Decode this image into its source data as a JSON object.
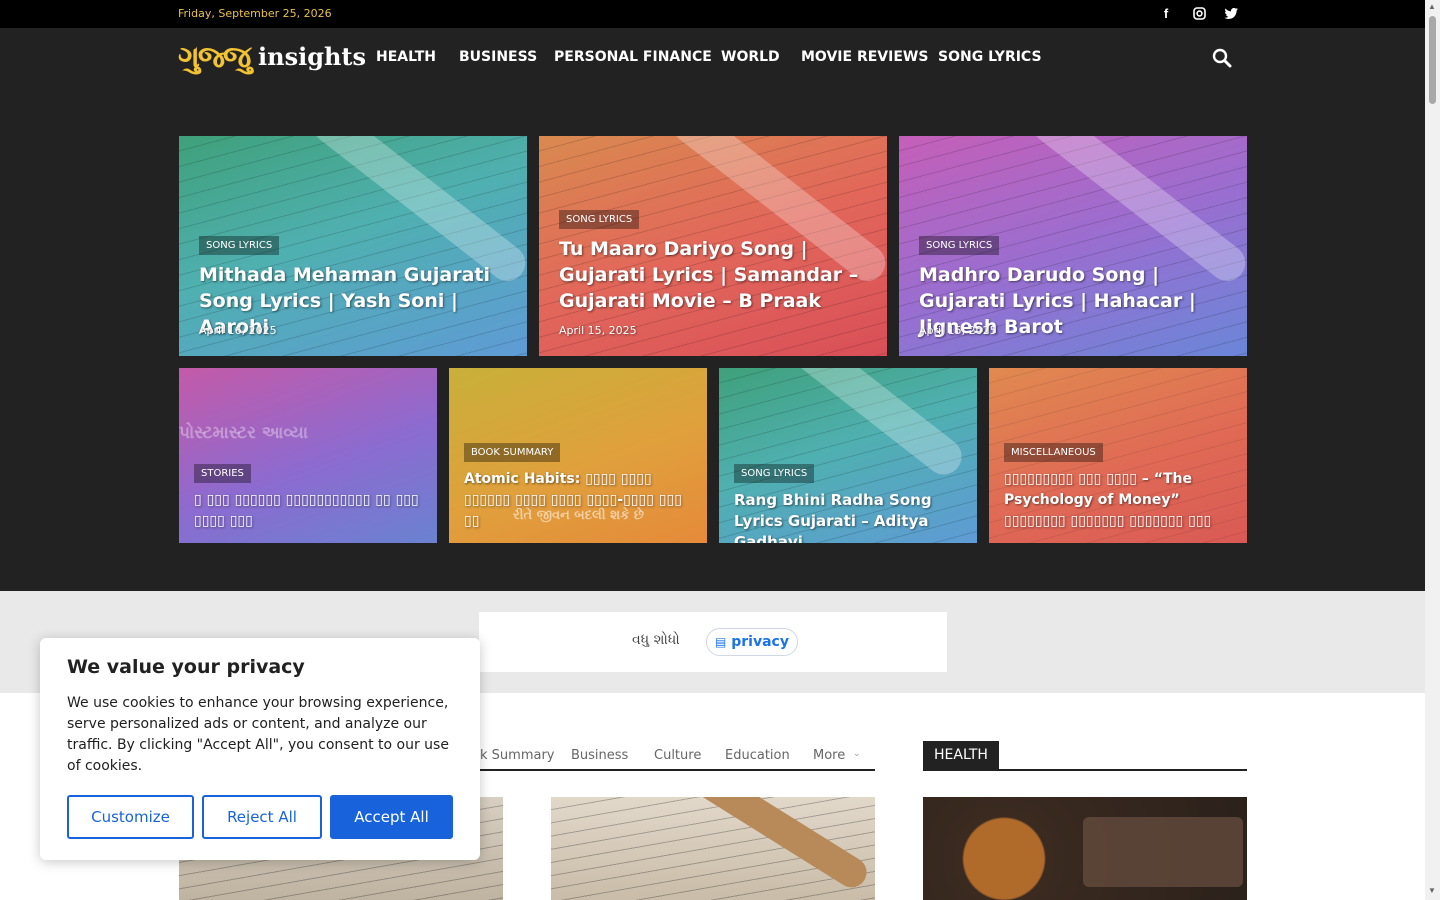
{
  "topbar": {
    "date": "Friday, September 25, 2026",
    "social": [
      "facebook-icon",
      "instagram-icon",
      "twitter-icon"
    ]
  },
  "header": {
    "logo_gujarati": "ગુજ્જુ",
    "logo_text": "insights",
    "nav": [
      "HEALTH",
      "BUSINESS",
      "PERSONAL FINANCE",
      "WORLD",
      "MOVIE REVIEWS",
      "SONG LYRICS"
    ]
  },
  "hero": {
    "top": [
      {
        "category": "SONG LYRICS",
        "title": "Mithada Mehaman Gujarati Song Lyrics | Yash Soni | Aarohi",
        "date": "April 16, 2025"
      },
      {
        "category": "SONG LYRICS",
        "title": "Tu Maaro Dariyo Song | Gujarati Lyrics | Samandar – Gujarati Movie – B Praak",
        "date": "April 15, 2025"
      },
      {
        "category": "SONG LYRICS",
        "title": "Madhro Darudo Song | Gujarati Lyrics | Hahacar | Jignesh Barot",
        "date": "April 15, 2025"
      }
    ],
    "bottom": [
      {
        "category": "STORIES",
        "title": "▯ ▯▯▯ ▯▯▯▯▯▯ ▯▯▯▯▯▯▯▯▯▯▯ ▯▯ ▯▯▯ ▯▯▯▯ ▯▯▯",
        "overlay": "પોસ્ટમાસ્ટર આવ્યા"
      },
      {
        "category": "BOOK SUMMARY",
        "title": "Atomic Habits: ▯▯▯▯ ▯▯▯▯ ▯▯▯▯▯▯ ▯▯▯▯ ▯▯▯▯ ▯▯▯▯-▯▯▯▯ ▯▯▯ ▯▯",
        "overlay": "રીતે જીવન બદલી શકે છે"
      },
      {
        "category": "SONG LYRICS",
        "title": "Rang Bhini Radha Song Lyrics Gujarati – Aditya Gadhavi",
        "overlay": ""
      },
      {
        "category": "MISCELLANEOUS",
        "title": "▯▯▯▯▯▯▯▯▯ ▯▯▯ ▯▯▯▯ – “The Psychology of Money” ▯▯▯▯▯▯▯▯ ▯▯▯▯▯▯▯ ▯▯▯▯▯▯▯ ▯▯▯",
        "overlay": ""
      }
    ]
  },
  "ad": {
    "label": "વધુ શોધો",
    "pill": "privacy"
  },
  "content": {
    "tabs": [
      "k Summary",
      "Business",
      "Culture",
      "Education",
      "More"
    ],
    "health_title": "HEALTH"
  },
  "cookie": {
    "title": "We value your privacy",
    "body": "We use cookies to enhance your browsing experience, serve personalized ads or content, and analyze our traffic. By clicking \"Accept All\", you consent to our use of cookies.",
    "customize": "Customize",
    "reject": "Reject All",
    "accept": "Accept All"
  }
}
